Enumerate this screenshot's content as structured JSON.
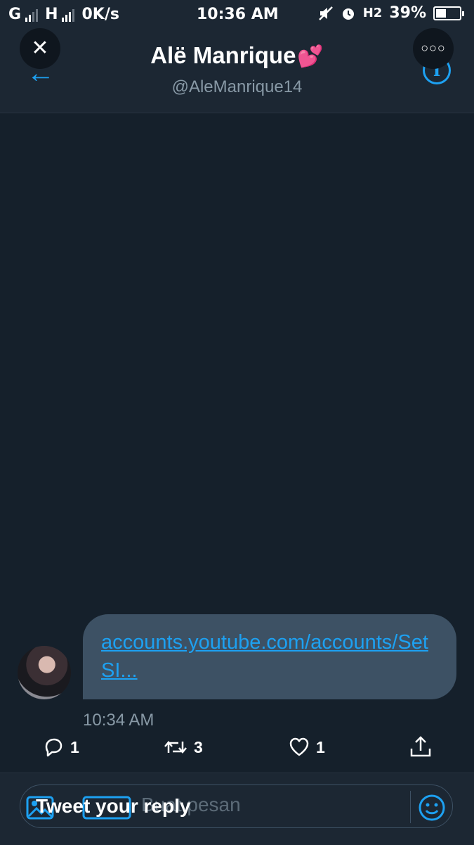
{
  "status_bar": {
    "carrier1": "G",
    "carrier2": "H",
    "speed": "0K/s",
    "time": "10:36 AM",
    "network": "H2",
    "battery": "39%",
    "battery_level": 0.39
  },
  "header": {
    "name": "Alë Manrique",
    "name_emoji": "💕",
    "handle": "@AleManrique14"
  },
  "message": {
    "link_text": "accounts.youtube.com/accounts/SetSI...",
    "timestamp": "10:34 AM"
  },
  "actions": {
    "reply_count": "1",
    "retweet_count": "3",
    "like_count": "1"
  },
  "compose": {
    "placeholder": "Tweet your reply",
    "ghost_placeholder": "Buat pesan"
  },
  "colors": {
    "accent": "#1da1f2",
    "background": "#15202b",
    "bubble": "#3d5164",
    "heart_emoji": "#e0457b"
  }
}
